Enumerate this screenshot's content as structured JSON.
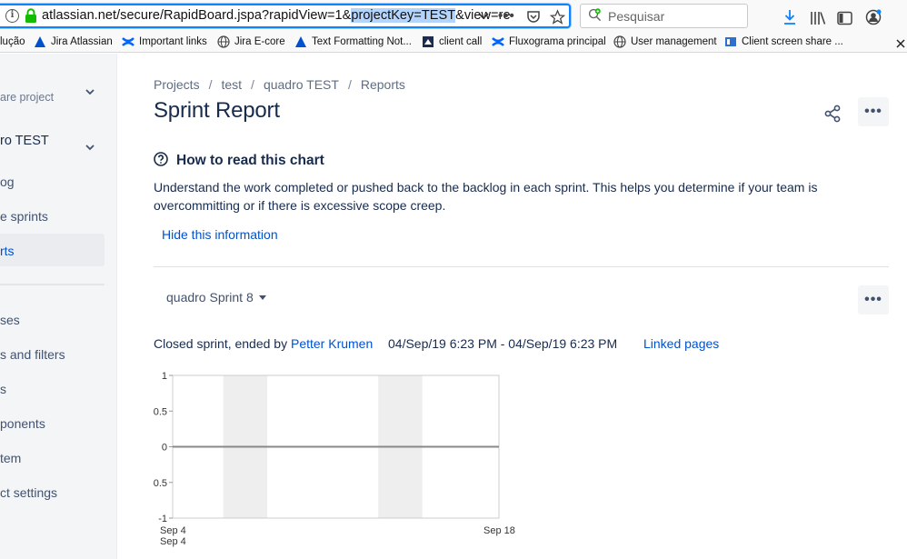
{
  "browser": {
    "url_prefix": "atlassian.net/secure/RapidBoard.jspa?rapidView=1&",
    "url_selected": "projectKey=TEST",
    "url_suffix": "&view=re",
    "search_placeholder": "Pesquisar",
    "bookmarks": [
      {
        "label": "lução",
        "icon": "page-icon"
      },
      {
        "label": "Jira Atlassian",
        "icon": "jira-icon"
      },
      {
        "label": "Important links",
        "icon": "confluence-icon"
      },
      {
        "label": "Jira E-core",
        "icon": "globe-icon"
      },
      {
        "label": "Text Formatting Not...",
        "icon": "jira-icon"
      },
      {
        "label": "client call",
        "icon": "page-icon"
      },
      {
        "label": "Fluxograma principal",
        "icon": "confluence-icon"
      },
      {
        "label": "User management",
        "icon": "globe-icon"
      },
      {
        "label": "Client screen share ...",
        "icon": "page-icon"
      }
    ]
  },
  "sidebar": {
    "items": [
      {
        "label": "are project"
      },
      {
        "label": "ro TEST"
      },
      {
        "label": "og"
      },
      {
        "label": "e sprints"
      },
      {
        "label": "rts"
      },
      {
        "label": "ses"
      },
      {
        "label": "s and filters"
      },
      {
        "label": "s"
      },
      {
        "label": "ponents"
      },
      {
        "label": "tem"
      },
      {
        "label": "ct settings"
      }
    ]
  },
  "breadcrumb": [
    "Projects",
    "test",
    "quadro TEST",
    "Reports"
  ],
  "page": {
    "title": "Sprint Report"
  },
  "help": {
    "title": "How to read this chart",
    "text": "Understand the work completed or pushed back to the backlog in each sprint. This helps you determine if your team is overcommitting or if there is excessive scope creep.",
    "hide_label": "Hide this information"
  },
  "sprint": {
    "selected": "quadro Sprint 8",
    "status_prefix": "Closed sprint, ended by",
    "ended_by": "Petter Krumen",
    "dates": "04/Sep/19 6:23 PM - 04/Sep/19 6:23 PM",
    "linked_pages": "Linked pages"
  },
  "chart_data": {
    "type": "line",
    "y_ticks": [
      "1",
      "0.5",
      "0",
      "0.5",
      "-1"
    ],
    "ylim": [
      -1,
      1
    ],
    "x_tick_labels": [
      "Sep 4",
      "Sep 18"
    ],
    "x_tick_sublabel": "Sep 4",
    "series": [
      {
        "x": [
          "Sep 4",
          "Sep 18"
        ],
        "values": [
          0,
          0
        ]
      }
    ],
    "shaded_ranges": [
      [
        0.155,
        0.29
      ],
      [
        0.63,
        0.765
      ]
    ],
    "colors": {
      "line": "#888888",
      "shade": "#EEEEEE",
      "frame": "#CCCCCC"
    }
  }
}
